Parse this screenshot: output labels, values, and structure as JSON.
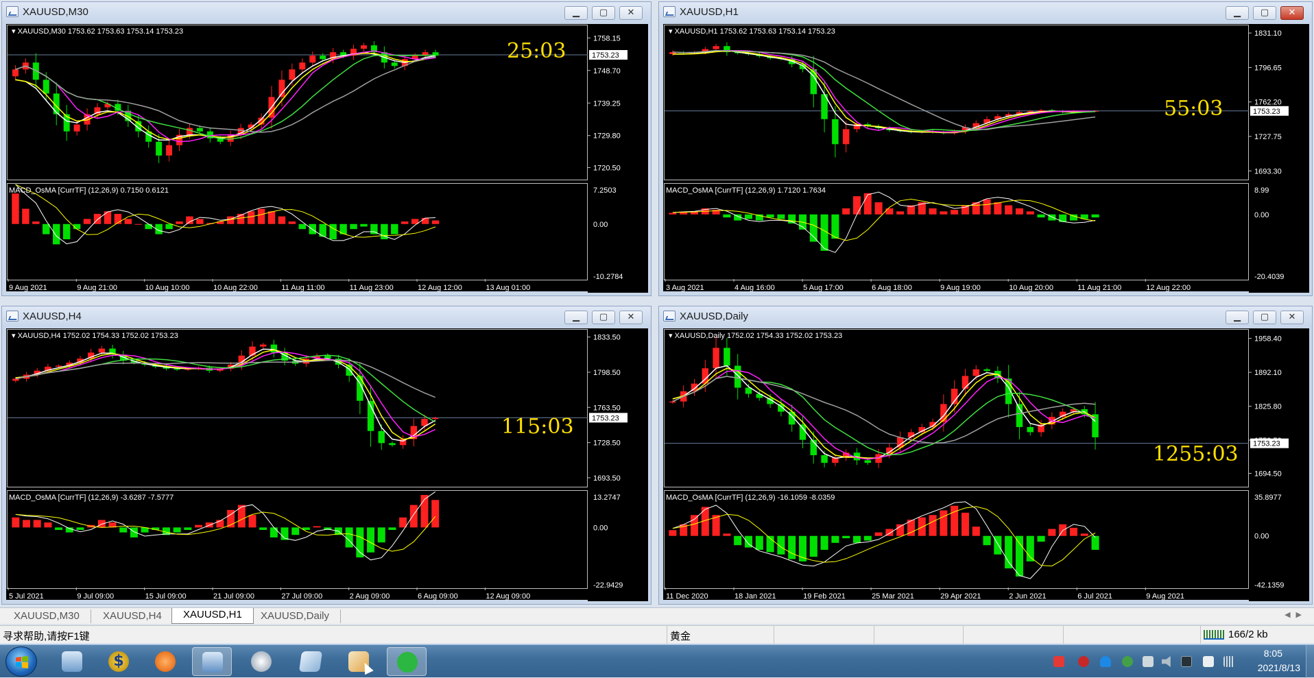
{
  "windows": [
    {
      "id": "m30",
      "title": "XAUUSD,M30",
      "close_active": false,
      "header": "XAUUSD,M30  1753.62 1753.63 1753.14 1753.23",
      "price_axis": [
        "1758.15",
        "1748.70",
        "1739.25",
        "1729.80",
        "1720.50"
      ],
      "current_price": "1753.23",
      "countdown": "25:03",
      "macd_header": "MACD_OsMA [CurrTF] (12,26,9) 0.7150 0.6121",
      "macd_axis": [
        "7.2503",
        "0.00",
        "-10.2784"
      ],
      "time_axis": [
        "9 Aug 2021",
        "9 Aug 21:00",
        "10 Aug 10:00",
        "10 Aug 22:00",
        "11 Aug 11:00",
        "11 Aug 23:00",
        "12 Aug 12:00",
        "13 Aug 01:00"
      ],
      "price_ylim": [
        1718,
        1761
      ],
      "macd_ylim": [
        -10.2784,
        7.2503
      ],
      "price_path": [
        1749,
        1751,
        1746,
        1742,
        1736,
        1731,
        1733,
        1736,
        1738,
        1739,
        1737,
        1734,
        1731,
        1728,
        1724,
        1727,
        1730,
        1732,
        1731,
        1729,
        1728,
        1730,
        1732,
        1733,
        1735,
        1741,
        1746,
        1749,
        1751,
        1753,
        1752,
        1754,
        1753,
        1755,
        1756,
        1754,
        1751,
        1750,
        1752,
        1753,
        1754,
        1753
      ],
      "macd_hist": [
        6,
        3,
        0.5,
        -2,
        -4,
        -3,
        -1,
        1,
        2,
        2.5,
        2,
        1,
        0,
        -1,
        -2,
        -1,
        0.5,
        1.5,
        1,
        0.2,
        0.5,
        1.5,
        2,
        2.5,
        3,
        2.5,
        1.5,
        0.5,
        -1,
        -2,
        -2.5,
        -3,
        -2,
        -1,
        -0.5,
        -2,
        -3,
        -2,
        0.5,
        1,
        1.2,
        0.7
      ],
      "sma_fast": [
        1746,
        1745,
        1742,
        1738,
        1735,
        1733,
        1734,
        1736,
        1737,
        1737,
        1736,
        1733,
        1731,
        1729,
        1728,
        1729,
        1730,
        1730,
        1730,
        1729,
        1729,
        1730,
        1731,
        1733,
        1736,
        1740,
        1744,
        1747,
        1749,
        1751,
        1752,
        1753,
        1753,
        1754,
        1754,
        1753,
        1752,
        1751,
        1751,
        1752,
        1753,
        1753
      ]
    },
    {
      "id": "h1",
      "title": "XAUUSD,H1",
      "close_active": true,
      "header": "XAUUSD,H1  1753.62 1753.63 1753.14 1753.23",
      "price_axis": [
        "1831.10",
        "1796.65",
        "1762.20",
        "1727.75",
        "1693.30"
      ],
      "current_price": "1753.23",
      "countdown": "55:03",
      "macd_header": "MACD_OsMA [CurrTF] (12,26,9) 1.7120 1.7634",
      "macd_axis": [
        "8.99",
        "0.00",
        "-20.4039"
      ],
      "time_axis": [
        "3 Aug 2021",
        "4 Aug 16:00",
        "5 Aug 17:00",
        "6 Aug 18:00",
        "9 Aug 19:00",
        "10 Aug 20:00",
        "11 Aug 21:00",
        "12 Aug 22:00"
      ],
      "price_ylim": [
        1688,
        1836
      ],
      "macd_ylim": [
        -20.4039,
        8.99
      ],
      "price_path": [
        1812,
        1811,
        1812,
        1815,
        1818,
        1812,
        1811,
        1810,
        1808,
        1806,
        1805,
        1800,
        1795,
        1770,
        1745,
        1720,
        1735,
        1740,
        1738,
        1736,
        1734,
        1733,
        1732,
        1733,
        1732,
        1731,
        1733,
        1737,
        1741,
        1745,
        1748,
        1750,
        1752,
        1753,
        1754,
        1753,
        1752,
        1753,
        1753,
        1753
      ],
      "macd_hist": [
        0.5,
        0.8,
        1,
        2,
        1.5,
        -1,
        -2,
        -1.5,
        -2,
        -1,
        -1.5,
        -3,
        -5,
        -9,
        -12,
        -8,
        2,
        6,
        7,
        4,
        2,
        1,
        3,
        4,
        2,
        1,
        1.5,
        3,
        4,
        5,
        4,
        3,
        2,
        1,
        -1,
        -2,
        -2.5,
        -2,
        -1.5,
        -1
      ],
      "sma_fast": [
        1810,
        1810,
        1811,
        1812,
        1814,
        1813,
        1811,
        1810,
        1808,
        1806,
        1805,
        1801,
        1796,
        1780,
        1760,
        1742,
        1738,
        1739,
        1738,
        1736,
        1734,
        1733,
        1732,
        1732,
        1732,
        1731,
        1732,
        1735,
        1739,
        1743,
        1747,
        1749,
        1751,
        1752,
        1753,
        1753,
        1752,
        1752,
        1753,
        1753
      ]
    },
    {
      "id": "h4",
      "title": "XAUUSD,H4",
      "close_active": false,
      "header": "XAUUSD,H4  1752.02 1754.33 1752.02 1753.23",
      "price_axis": [
        "1833.50",
        "1798.50",
        "1763.50",
        "1728.50",
        "1693.50"
      ],
      "current_price": "1753.23",
      "countdown": "115:03",
      "macd_header": "MACD_OsMA [CurrTF] (12,26,9) -3.6287 -7.5777",
      "macd_axis": [
        "13.2747",
        "0.00",
        "-22.9429"
      ],
      "time_axis": [
        "5 Jul 2021",
        "9 Jul 09:00",
        "15 Jul 09:00",
        "21 Jul 09:00",
        "27 Jul 09:00",
        "2 Aug 09:00",
        "6 Aug 09:00",
        "12 Aug 09:00"
      ],
      "price_ylim": [
        1688,
        1838
      ],
      "macd_ylim": [
        -22.9429,
        13.2747
      ],
      "price_path": [
        1792,
        1796,
        1800,
        1804,
        1805,
        1808,
        1812,
        1818,
        1822,
        1816,
        1810,
        1808,
        1806,
        1804,
        1802,
        1801,
        1802,
        1803,
        1800,
        1802,
        1806,
        1815,
        1824,
        1826,
        1818,
        1810,
        1807,
        1812,
        1815,
        1812,
        1806,
        1795,
        1770,
        1740,
        1728,
        1726,
        1732,
        1745,
        1752,
        1753
      ],
      "macd_hist": [
        4,
        3,
        3,
        2,
        -1,
        -2,
        -1,
        1,
        3,
        2,
        -2,
        -4,
        -2,
        -1,
        -3,
        -2,
        -1,
        1,
        2,
        3,
        7,
        9,
        5,
        -1,
        -4,
        -5,
        -3,
        -1,
        0.5,
        -1,
        -3,
        -8,
        -12,
        -10,
        -6,
        -1,
        4,
        9,
        13,
        11
      ],
      "sma_fast": [
        1793,
        1795,
        1799,
        1802,
        1804,
        1807,
        1811,
        1816,
        1819,
        1816,
        1811,
        1808,
        1806,
        1804,
        1803,
        1802,
        1802,
        1802,
        1801,
        1802,
        1805,
        1812,
        1820,
        1823,
        1819,
        1812,
        1808,
        1810,
        1813,
        1811,
        1806,
        1797,
        1778,
        1752,
        1735,
        1729,
        1731,
        1740,
        1749,
        1752
      ]
    },
    {
      "id": "daily",
      "title": "XAUUSD,Daily",
      "close_active": false,
      "header": "XAUUSD,Daily  1752.02 1754.33 1752.02 1753.23",
      "price_axis": [
        "1958.40",
        "1892.10",
        "1825.80",
        "1759.50",
        "1694.50"
      ],
      "current_price": "1753.23",
      "countdown": "1255:03",
      "macd_header": "MACD_OsMA [CurrTF] (12,26,9) -16.1059 -8.0359",
      "macd_axis": [
        "35.8977",
        "0.00",
        "-42.1359"
      ],
      "time_axis": [
        "11 Dec 2020",
        "18 Jan 2021",
        "19 Feb 2021",
        "25 Mar 2021",
        "29 Apr 2021",
        "2 Jun 2021",
        "6 Jul 2021",
        "9 Aug 2021"
      ],
      "price_ylim": [
        1675,
        1970
      ],
      "macd_ylim": [
        -42.1359,
        35.8977
      ],
      "price_path": [
        1835,
        1855,
        1870,
        1900,
        1940,
        1905,
        1862,
        1850,
        1842,
        1830,
        1815,
        1790,
        1760,
        1730,
        1715,
        1725,
        1735,
        1720,
        1715,
        1732,
        1745,
        1765,
        1775,
        1785,
        1795,
        1830,
        1860,
        1885,
        1898,
        1895,
        1880,
        1830,
        1785,
        1775,
        1790,
        1805,
        1815,
        1820,
        1810,
        1765
      ],
      "macd_hist": [
        5,
        10,
        18,
        25,
        18,
        2,
        -8,
        -10,
        -12,
        -14,
        -16,
        -20,
        -22,
        -18,
        -12,
        -6,
        -2,
        -6,
        -4,
        3,
        6,
        10,
        14,
        16,
        18,
        22,
        26,
        20,
        8,
        -8,
        -16,
        -28,
        -35,
        -22,
        -5,
        6,
        10,
        7,
        2,
        -12
      ],
      "sma_fast": [
        1840,
        1852,
        1868,
        1890,
        1910,
        1900,
        1872,
        1856,
        1845,
        1833,
        1818,
        1796,
        1770,
        1742,
        1724,
        1724,
        1730,
        1724,
        1720,
        1730,
        1742,
        1760,
        1772,
        1782,
        1792,
        1822,
        1850,
        1875,
        1890,
        1893,
        1883,
        1842,
        1800,
        1784,
        1790,
        1802,
        1812,
        1818,
        1812,
        1780
      ]
    }
  ],
  "tabs": [
    {
      "label": "XAUUSD,M30",
      "active": false
    },
    {
      "label": "XAUUSD,H4",
      "active": false
    },
    {
      "label": "XAUUSD,H1",
      "active": true
    },
    {
      "label": "XAUUSD,Daily",
      "active": false
    }
  ],
  "status": {
    "help": "寻求帮助,请按F1键",
    "profile": "黄金",
    "traffic": "166/2 kb"
  },
  "clock": {
    "time": "8:05",
    "date": "2021/8/13"
  },
  "colors": {
    "bull": "#ff2020",
    "bear": "#00e000",
    "ma_white": "#ffffff",
    "ma_yellow": "#ffff00",
    "ma_magenta": "#ff20ff",
    "ma_green": "#40e040",
    "ma_gray": "#a0a0a0",
    "countdown": "#ffe000"
  }
}
